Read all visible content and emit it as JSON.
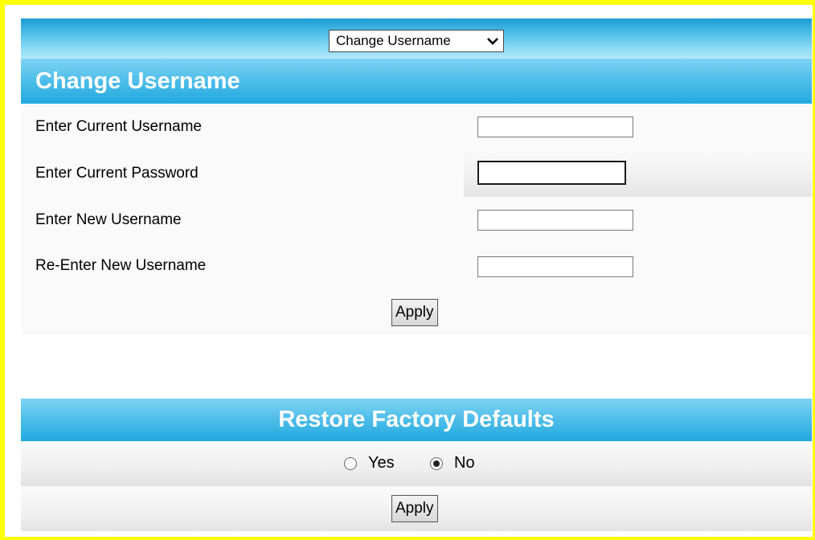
{
  "nav": {
    "select_value": "Change Username"
  },
  "change_username": {
    "title": "Change Username",
    "fields": [
      {
        "label": "Enter Current Username",
        "value": ""
      },
      {
        "label": "Enter Current Password",
        "value": ""
      },
      {
        "label": "Enter New Username",
        "value": ""
      },
      {
        "label": "Re-Enter New Username",
        "value": ""
      }
    ],
    "apply_label": "Apply"
  },
  "restore_defaults": {
    "title": "Restore Factory Defaults",
    "options": [
      {
        "label": "Yes",
        "checked": false
      },
      {
        "label": "No",
        "checked": true
      }
    ],
    "apply_label": "Apply"
  },
  "colors": {
    "frame_border": "#ffff00",
    "header_blue": "#22a9e0",
    "header_text": "#ffffff"
  },
  "icons": {
    "dropdown": "chevron-down-icon"
  }
}
